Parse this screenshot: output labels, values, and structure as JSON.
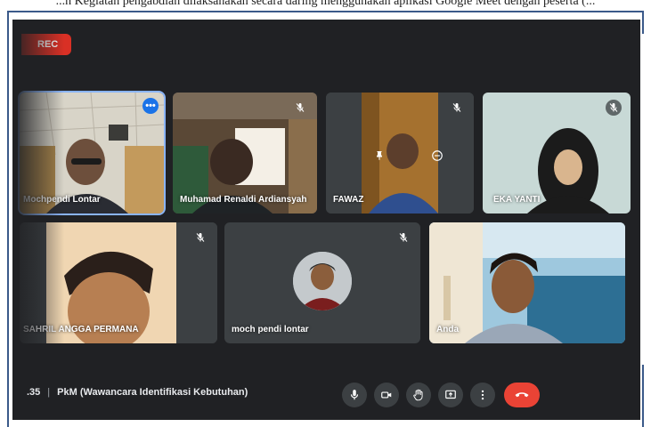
{
  "doc_header": "...n Kegiatan pengabdian dilaksanakan secara daring menggunakan aplikasi Google Meet dengan peserta (...",
  "recording": {
    "label": "REC"
  },
  "participants": [
    {
      "name": "Mochpendi Lontar",
      "muted": false,
      "active": true
    },
    {
      "name": "Muhamad Renaldi Ardiansyah",
      "muted": true
    },
    {
      "name": "FAWAZ",
      "muted": true
    },
    {
      "name": "EKA YANTI",
      "muted": true
    },
    {
      "name": "SAHRIL ANGGA PERMANA",
      "muted": true
    },
    {
      "name": "moch pendi lontar",
      "muted": true
    },
    {
      "name": "Anda",
      "muted": false
    }
  ],
  "meeting": {
    "time": ".35",
    "title": "PkM (Wawancara Identifikasi Kebutuhan)"
  },
  "icons": {
    "more": "more-options-icon",
    "mute": "mic-off-icon",
    "pin": "pin-icon",
    "remove": "remove-icon",
    "mic": "mic-icon",
    "camera": "camera-icon",
    "hand": "raise-hand-icon",
    "present": "present-screen-icon",
    "menu": "more-vert-icon",
    "end": "end-call-icon"
  },
  "colors": {
    "background": "#202124",
    "tile": "#3c4043",
    "rec": "#d93025",
    "active_border": "#8ab4f8",
    "end_call": "#ea4335",
    "control": "#3c4043"
  }
}
